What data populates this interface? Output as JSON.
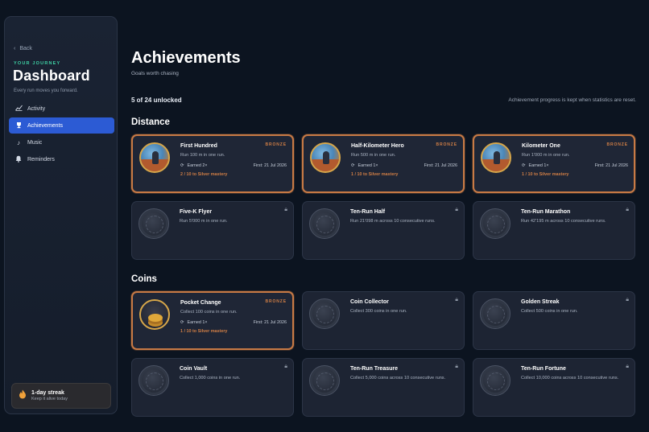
{
  "sidebar": {
    "back_label": "Back",
    "eyebrow": "YOUR JOURNEY",
    "title": "Dashboard",
    "subtitle": "Every run moves you forward.",
    "nav": [
      {
        "label": "Activity",
        "icon": "chart-line-icon"
      },
      {
        "label": "Achievements",
        "icon": "trophy-icon",
        "active": true
      },
      {
        "label": "Music",
        "icon": "music-note-icon"
      },
      {
        "label": "Reminders",
        "icon": "bell-icon"
      }
    ],
    "streak": {
      "title": "1-day streak",
      "subtitle": "Keep it alive today",
      "icon": "flame-icon"
    }
  },
  "main": {
    "title": "Achievements",
    "subtitle": "Goals worth chasing",
    "unlocked_count": "5 of 24 unlocked",
    "note": "Achievement progress is kept when statistics are reset."
  },
  "sections": [
    {
      "title": "Distance",
      "cards": [
        {
          "title": "First Hundred",
          "desc": "Run 100 m in one run.",
          "tier": "BRONZE",
          "earned": "Earned 2×",
          "first": "First: 21 Jul 2026",
          "progress": "2 / 10 to Silver mastery"
        },
        {
          "title": "Half-Kilometer Hero",
          "desc": "Run 500 m in one run.",
          "tier": "BRONZE",
          "earned": "Earned 1×",
          "first": "First: 21 Jul 2026",
          "progress": "1 / 10 to Silver mastery"
        },
        {
          "title": "Kilometer One",
          "desc": "Run 1'000 m in one run.",
          "tier": "BRONZE",
          "earned": "Earned 1×",
          "first": "First: 21 Jul 2026",
          "progress": "1 / 10 to Silver mastery"
        },
        {
          "title": "Five-K Flyer",
          "desc": "Run 5'000 m in one run.",
          "locked": true
        },
        {
          "title": "Ten-Run Half",
          "desc": "Run 21'098 m across 10 consecutive runs.",
          "locked": true
        },
        {
          "title": "Ten-Run Marathon",
          "desc": "Run 42'195 m across 10 consecutive runs.",
          "locked": true
        }
      ]
    },
    {
      "title": "Coins",
      "cards": [
        {
          "title": "Pocket Change",
          "desc": "Collect 100 coins in one run.",
          "tier": "BRONZE",
          "earned": "Earned 1×",
          "first": "First: 21 Jul 2026",
          "progress": "1 / 10 to Silver mastery"
        },
        {
          "title": "Coin Collector",
          "desc": "Collect 300 coins in one run.",
          "locked": true
        },
        {
          "title": "Golden Streak",
          "desc": "Collect 500 coins in one run.",
          "locked": true
        },
        {
          "title": "Coin Vault",
          "desc": "Collect 1,000 coins in one run.",
          "locked": true
        },
        {
          "title": "Ten-Run Treasure",
          "desc": "Collect 5,000 coins across 10 consecutive runs.",
          "locked": true
        },
        {
          "title": "Ten-Run Fortune",
          "desc": "Collect 10,000 coins across 10 consecutive runs.",
          "locked": true
        }
      ]
    }
  ],
  "colors": {
    "accent": "#2c5bd4",
    "bronze": "#c87a45",
    "teal": "#3fd3a6",
    "background": "#0c1420"
  }
}
